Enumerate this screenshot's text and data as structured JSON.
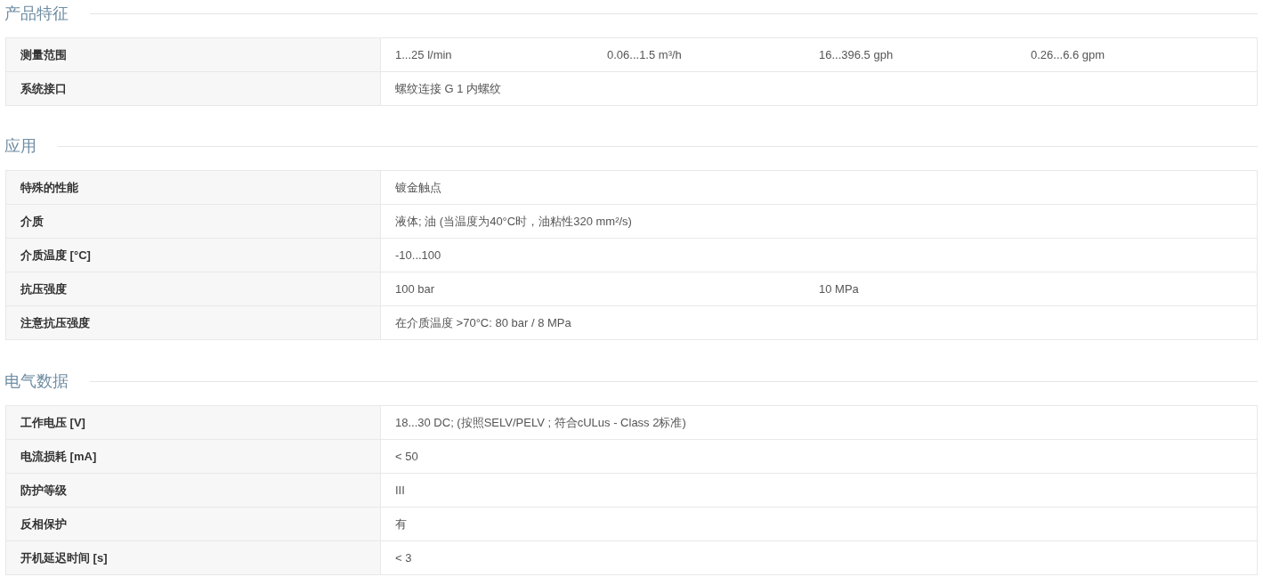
{
  "sections": [
    {
      "title": "产品特征",
      "rows": [
        {
          "label": "测量范围",
          "values": [
            "1...25 l/min",
            "0.06...1.5 m³/h",
            "16...396.5 gph",
            "0.26...6.6 gpm"
          ]
        },
        {
          "label": "系统接口",
          "values": [
            "螺纹连接 G 1 内螺纹"
          ]
        }
      ]
    },
    {
      "title": "应用",
      "rows": [
        {
          "label": "特殊的性能",
          "values": [
            "镀金触点"
          ]
        },
        {
          "label": "介质",
          "values": [
            "液体; 油 (当温度为40°C时，油粘性320 mm²/s)"
          ]
        },
        {
          "label": "介质温度 [°C]",
          "values": [
            "-10...100"
          ]
        },
        {
          "label": "抗压强度",
          "values": [
            "100 bar",
            "10 MPa"
          ]
        },
        {
          "label": "注意抗压强度",
          "values": [
            "在介质温度 >70°C: 80 bar / 8 MPa"
          ]
        }
      ]
    },
    {
      "title": "电气数据",
      "rows": [
        {
          "label": "工作电压 [V]",
          "values": [
            "18...30 DC; (按照SELV/PELV ; 符合cULus - Class 2标准)"
          ]
        },
        {
          "label": "电流损耗 [mA]",
          "values": [
            "< 50"
          ]
        },
        {
          "label": "防护等级",
          "values": [
            "III"
          ]
        },
        {
          "label": "反相保护",
          "values": [
            "有"
          ]
        },
        {
          "label": "开机延迟时间 [s]",
          "values": [
            "< 3"
          ]
        }
      ]
    }
  ]
}
